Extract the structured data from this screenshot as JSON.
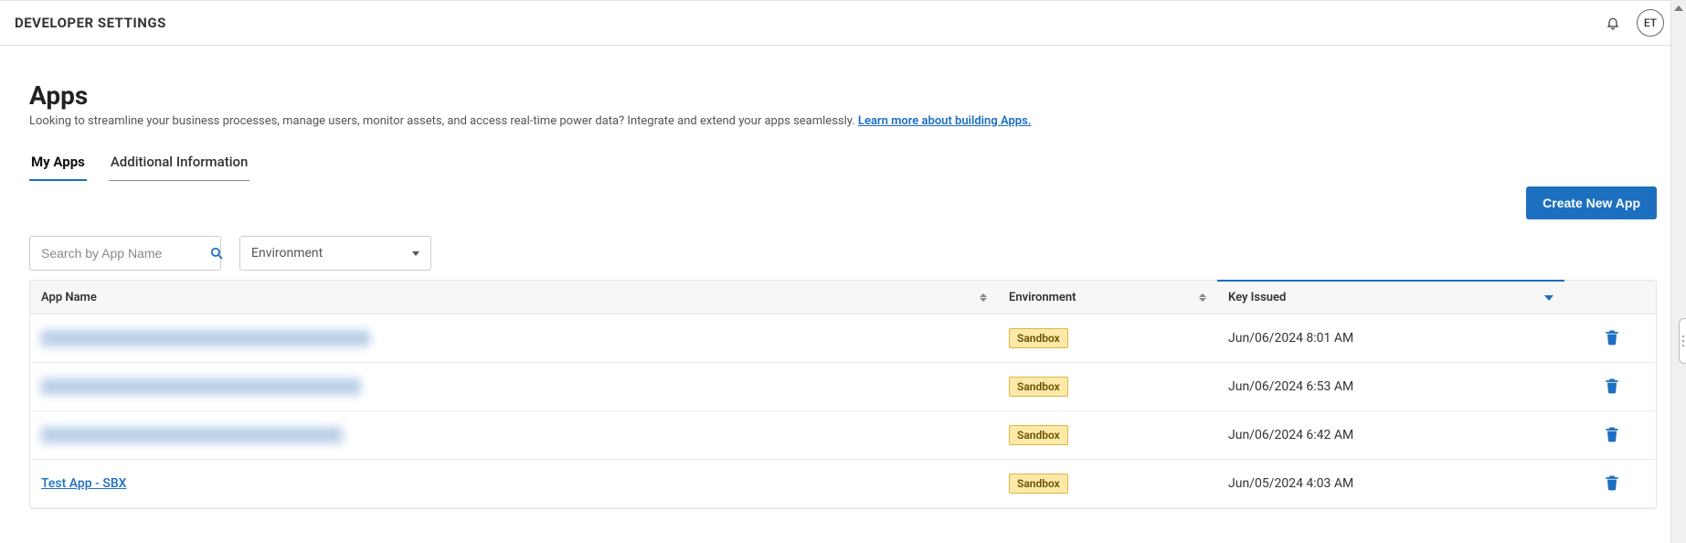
{
  "topbar": {
    "title": "DEVELOPER SETTINGS",
    "avatar_initials": "ET"
  },
  "page": {
    "heading": "Apps",
    "subtext": "Looking to streamline your business processes, manage users, monitor assets, and access real-time power data? Integrate and extend your apps seamlessly. ",
    "learn_link": "Learn more about building Apps."
  },
  "tabs": {
    "my_apps": "My Apps",
    "additional_info": "Additional Information",
    "active": "my_apps"
  },
  "actions": {
    "create_new_app": "Create New App"
  },
  "filters": {
    "search_placeholder": "Search by App Name",
    "env_label": "Environment"
  },
  "columns": {
    "app_name": "App Name",
    "environment": "Environment",
    "key_issued": "Key Issued"
  },
  "env_badge": "Sandbox",
  "rows": [
    {
      "name": "",
      "name_hidden": true,
      "blur_width": 360,
      "env": "Sandbox",
      "key_issued": "Jun/06/2024 8:01 AM"
    },
    {
      "name": "",
      "name_hidden": true,
      "blur_width": 350,
      "env": "Sandbox",
      "key_issued": "Jun/06/2024 6:53 AM"
    },
    {
      "name": "",
      "name_hidden": true,
      "blur_width": 330,
      "env": "Sandbox",
      "key_issued": "Jun/06/2024 6:42 AM"
    },
    {
      "name": "Test App - SBX",
      "name_hidden": false,
      "env": "Sandbox",
      "key_issued": "Jun/05/2024 4:03 AM"
    }
  ]
}
